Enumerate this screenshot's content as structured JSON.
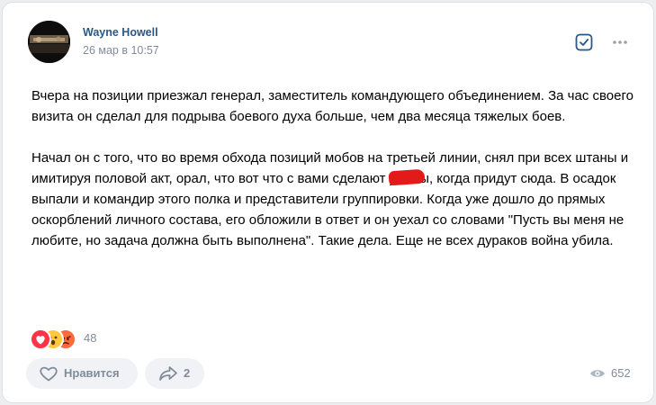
{
  "post": {
    "author": "Wayne Howell",
    "date": "26 мар в 10:57",
    "paragraph1": "Вчера на позиции приезжал генерал, заместитель командующего объединением. За час своего визита он сделал для подрыва боевого духа больше, чем два месяца тяжелых боев.",
    "paragraph2_before": "Начал он с того, что во время обхода позиций мобов на третьей линии, снял при всех штаны и имитируя половой акт, орал, что вот что с вами сделают у",
    "paragraph2_after": "ы, когда придут сюда. В осадок выпали и командир этого полка и представители группировки. Когда уже дошло до прямых оскорблений личного состава, его обложили в ответ и он уехал со словами \"Пусть вы меня не любите, но задача должна быть выполнена\". Такие дела. Еще не всех дураков война убила."
  },
  "reactions": {
    "icons": [
      "heart-icon",
      "surprised-face-icon",
      "angry-face-icon"
    ],
    "count": "48"
  },
  "actions": {
    "like_label": "Нравится",
    "share_count": "2",
    "views_count": "652"
  },
  "colors": {
    "accent": "#2a5885",
    "secondary_text": "#818c99",
    "button_bg": "#f0f2f5",
    "redaction": "#e21a1a"
  }
}
